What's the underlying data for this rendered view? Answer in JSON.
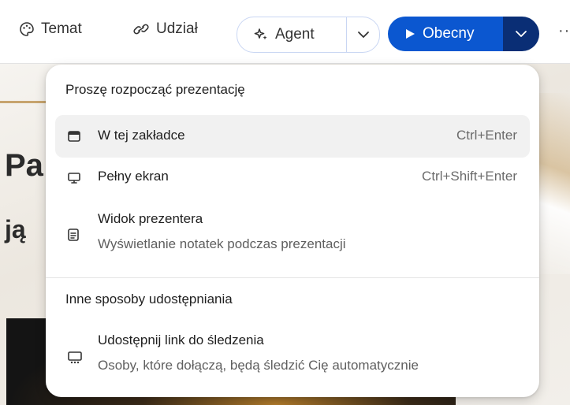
{
  "toolbar": {
    "temat_label": "Temat",
    "udzial_label": "Udział",
    "agent_label": "Agent",
    "present_label": "Obecny",
    "more_label": "···",
    "accent_color": "#0b57d0",
    "accent_dark_color": "#0a2e75"
  },
  "menu": {
    "heading_start": "Proszę rozpocząć prezentację",
    "items": [
      {
        "label": "W tej zakładce",
        "shortcut": "Ctrl+Enter",
        "icon": "browser-tab-icon"
      },
      {
        "label": "Pełny ekran",
        "shortcut": "Ctrl+Shift+Enter",
        "icon": "monitor-icon"
      },
      {
        "label": "Widok prezentera",
        "description": "Wyświetlanie notatek podczas prezentacji",
        "icon": "notes-icon"
      }
    ],
    "heading_share": "Inne sposoby udostępniania",
    "share_items": [
      {
        "label": "Udostępnij link do śledzenia",
        "description": "Osoby, które dołączą, będą śledzić Cię automatycznie",
        "icon": "cast-icon"
      }
    ]
  },
  "background": {
    "title_fragment": "Pa",
    "subtitle_fragment": "ją"
  }
}
